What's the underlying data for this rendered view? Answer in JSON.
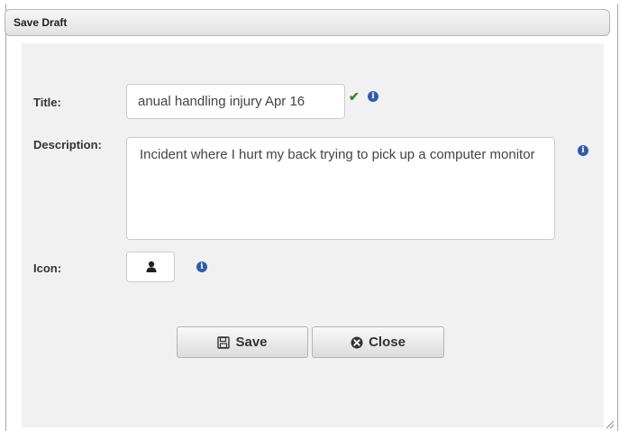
{
  "dialog": {
    "title": "Save Draft"
  },
  "form": {
    "title_label": "Title:",
    "title_value": "anual handling injury Apr 16",
    "description_label": "Description:",
    "description_value": "Incident where I hurt my back trying to pick up a computer monitor",
    "icon_label": "Icon:",
    "selected_icon": "user-icon"
  },
  "buttons": {
    "save_label": "Save",
    "close_label": "Close"
  },
  "icons": {
    "info": "info-icon",
    "valid": "checkmark-icon",
    "save": "floppy-disk-icon",
    "close": "close-circle-icon"
  },
  "colors": {
    "info": "#2a5db0",
    "valid": "#2e8b22",
    "panel": "#f1f1f1"
  }
}
